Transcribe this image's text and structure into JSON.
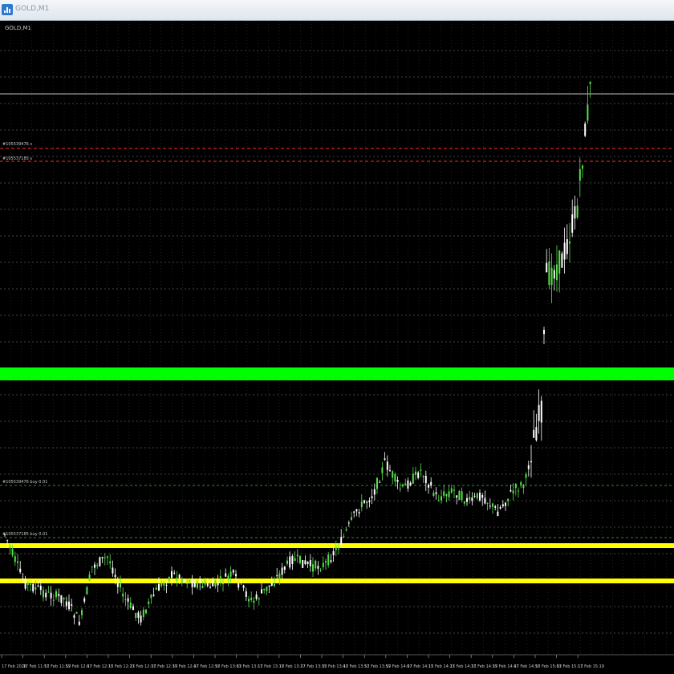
{
  "window": {
    "title": "GOLD,M1",
    "icon": "chart-window-icon"
  },
  "chart": {
    "symbol_label": "GOLD,M1",
    "colors": {
      "background": "#000000",
      "grid": "#5a5a5a",
      "bull_candle": "#55e04a",
      "bear_candle": "#ffffff",
      "green_zone": "#00ff00",
      "yellow_lines": "#ffff00",
      "order_lines": "#ff2a2a",
      "entry_lines": "#2e8b2e",
      "price_line": "#c0c0c0"
    },
    "order_labels": {
      "sell_1": "#105539476 s",
      "sell_2": "#105537185 s",
      "buy_1": "#105539476 buy 0.01",
      "buy_2": "#105537185 buy 0.01"
    },
    "time_labels": [
      "17 Feb 2026",
      "17 Feb 11:51",
      "17 Feb 11:59",
      "17 Feb 12:07",
      "17 Feb 12:15",
      "17 Feb 12:23",
      "17 Feb 12:31",
      "17 Feb 12:39",
      "17 Feb 12:47",
      "17 Feb 12:55",
      "17 Feb 13:03",
      "17 Feb 13:11",
      "17 Feb 13:19",
      "17 Feb 13:27",
      "17 Feb 13:35",
      "17 Feb 13:43",
      "17 Feb 13:51",
      "17 Feb 13:59",
      "17 Feb 14:07",
      "17 Feb 14:15",
      "17 Feb 14:23",
      "17 Feb 14:31",
      "17 Feb 14:39",
      "17 Feb 14:47",
      "17 Feb 14:55",
      "17 Feb 15:03",
      "17 Feb 15:11",
      "17 Feb 15:19"
    ]
  }
}
